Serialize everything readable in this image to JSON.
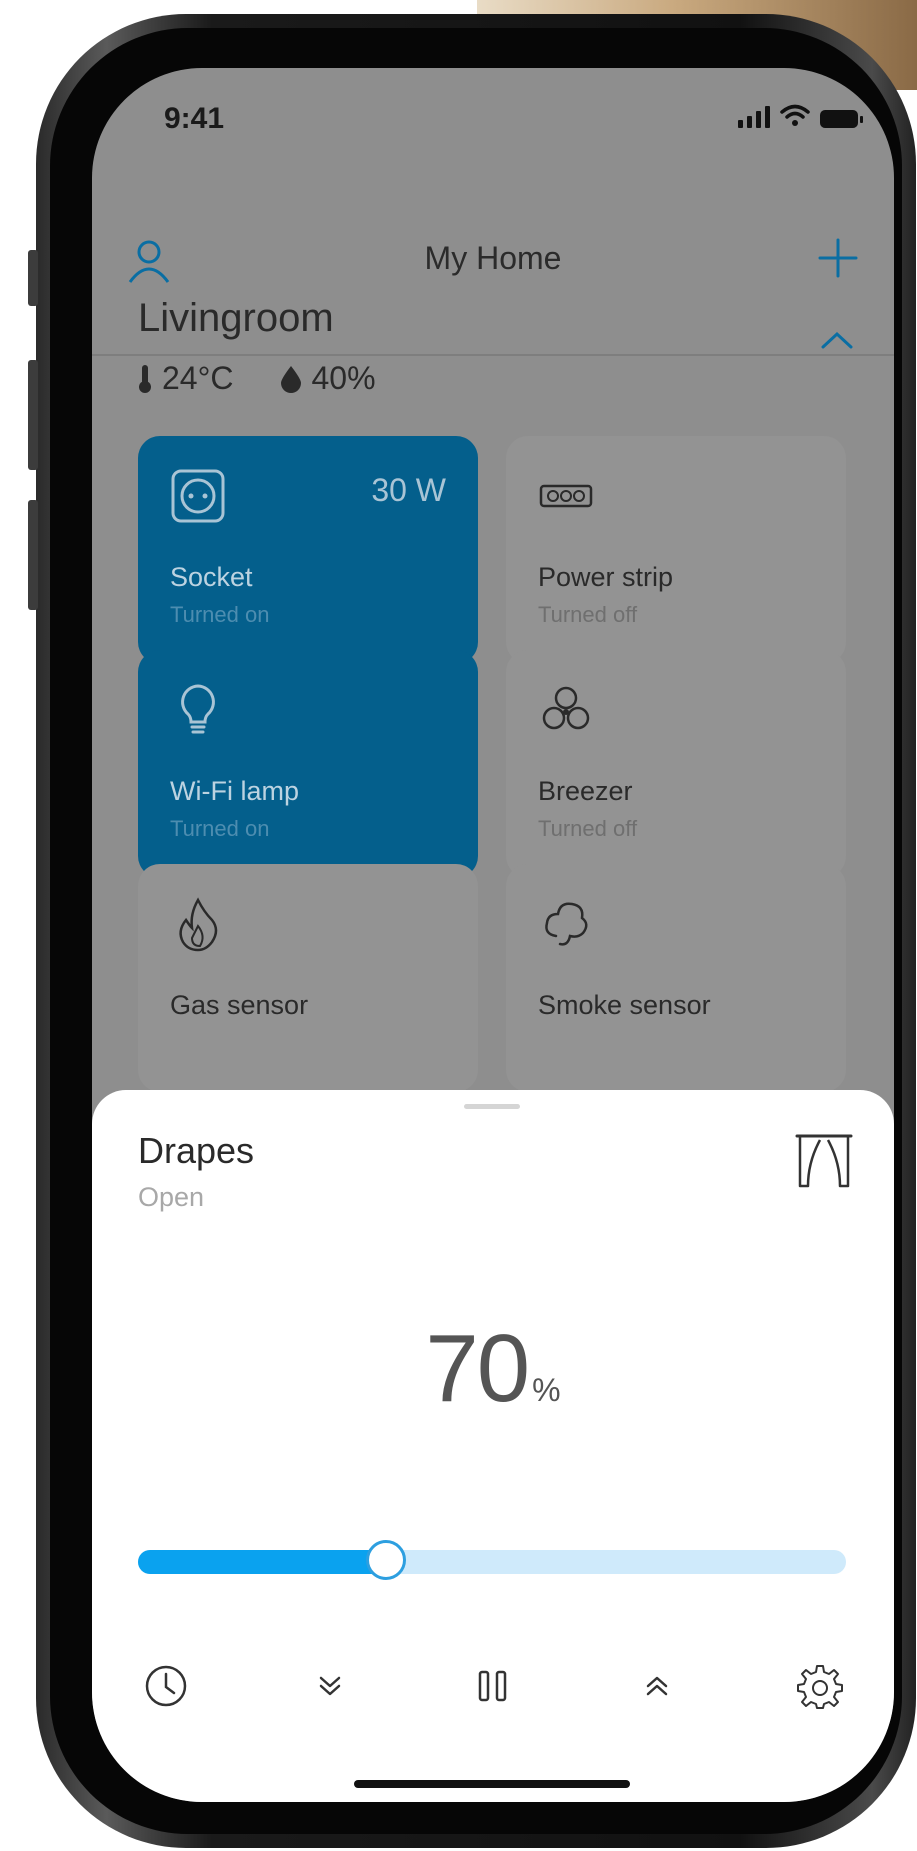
{
  "status_bar": {
    "time": "9:41"
  },
  "navbar": {
    "title": "My Home",
    "left_icon": "user-icon",
    "right_icon": "plus-icon"
  },
  "room": {
    "name": "Livingroom",
    "temperature": "24°C",
    "humidity": "40%"
  },
  "devices": [
    {
      "name": "Socket",
      "state": "Turned on",
      "power": "30 W",
      "icon": "socket-icon",
      "on": true
    },
    {
      "name": "Power strip",
      "state": "Turned off",
      "icon": "power-strip-icon",
      "on": false
    },
    {
      "name": "Wi-Fi  lamp",
      "state": "Turned on",
      "icon": "lightbulb-icon",
      "on": true
    },
    {
      "name": "Breezer",
      "state": "Turned off",
      "icon": "fan-icon",
      "on": false
    },
    {
      "name": "Gas sensor",
      "icon": "flame-icon",
      "on": false
    },
    {
      "name": "Smoke sensor",
      "icon": "cloud-icon",
      "on": false
    }
  ],
  "sheet": {
    "title": "Drapes",
    "subtitle": "Open",
    "value": "70",
    "unit": "%",
    "slider_fraction": 0.35
  },
  "colors": {
    "accent": "#0aa2ef",
    "tile_on": "#045f8c",
    "slider_track": "#cfeafb"
  }
}
